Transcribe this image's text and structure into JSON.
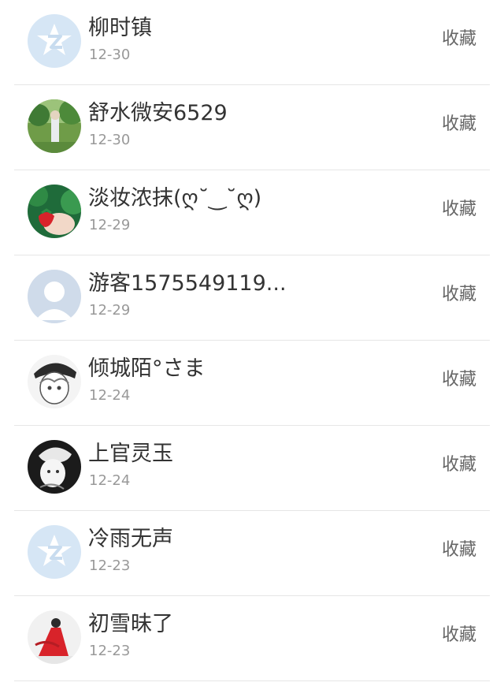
{
  "items": [
    {
      "name": "柳时镇",
      "date": "12-30",
      "action": "收藏",
      "avatar": "qzone-default-avatar"
    },
    {
      "name": "舒水微安6529",
      "date": "12-30",
      "action": "收藏",
      "avatar": "scenery-avatar"
    },
    {
      "name": "淡妆浓抹(ღ˘‿˘ღ)",
      "date": "12-29",
      "action": "收藏",
      "avatar": "strawberry-avatar"
    },
    {
      "name": "游客1575549119...",
      "date": "12-29",
      "action": "收藏",
      "avatar": "default-user-avatar"
    },
    {
      "name": "倾城陌°さま",
      "date": "12-24",
      "action": "收藏",
      "avatar": "anime-avatar"
    },
    {
      "name": "上官灵玉",
      "date": "12-24",
      "action": "收藏",
      "avatar": "anime-dark-avatar"
    },
    {
      "name": "冷雨无声",
      "date": "12-23",
      "action": "收藏",
      "avatar": "qzone-default-avatar"
    },
    {
      "name": "初雪昧了",
      "date": "12-23",
      "action": "收藏",
      "avatar": "red-dress-avatar"
    }
  ],
  "colors": {
    "name": "#333333",
    "date": "#999999",
    "action": "#666666",
    "divider": "#e6e6e6"
  }
}
